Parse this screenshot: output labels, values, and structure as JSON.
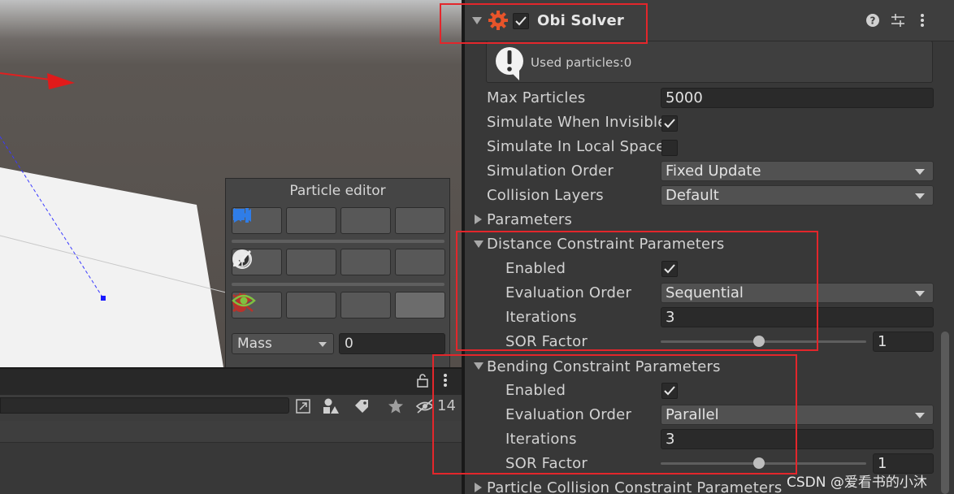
{
  "particle_editor": {
    "title": "Particle editor",
    "property_select": "Mass",
    "property_value": "0"
  },
  "hierarchy": {
    "hidden_count": "14"
  },
  "inspector": {
    "component_title": "Obi Solver",
    "component_enabled": true,
    "help_message": "Used particles:0",
    "max_particles_label": "Max Particles",
    "max_particles_value": "5000",
    "simulate_invisible_label": "Simulate When Invisible",
    "simulate_invisible": true,
    "simulate_local_label": "Simulate In Local Space",
    "simulate_local": false,
    "simulation_order_label": "Simulation Order",
    "simulation_order_value": "Fixed Update",
    "collision_layers_label": "Collision Layers",
    "collision_layers_value": "Default",
    "parameters_label": "Parameters",
    "distance": {
      "title": "Distance Constraint Parameters",
      "enabled_label": "Enabled",
      "enabled": true,
      "eval_order_label": "Evaluation Order",
      "eval_order_value": "Sequential",
      "iterations_label": "Iterations",
      "iterations_value": "3",
      "sor_label": "SOR Factor",
      "sor_value": "1"
    },
    "bending": {
      "title": "Bending Constraint Parameters",
      "enabled_label": "Enabled",
      "enabled": true,
      "eval_order_label": "Evaluation Order",
      "eval_order_value": "Parallel",
      "iterations_label": "Iterations",
      "iterations_value": "3",
      "sor_label": "SOR Factor",
      "sor_value": "1"
    },
    "particle_collision_title": "Particle Collision Constraint Parameters"
  },
  "watermark": "CSDN @爱看书的小沐",
  "colors": {
    "highlight_red": "#e3262b",
    "play_blue": "#2f7de8",
    "pin_red": "#b8322b",
    "eye_green": "#7fc241"
  }
}
